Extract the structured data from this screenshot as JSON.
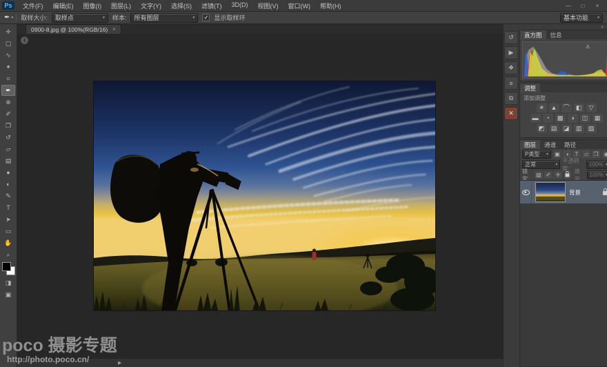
{
  "colors": {
    "hist_gray": "#8d8d8d",
    "hist_red": "#d23a2e",
    "hist_green": "#3fae3f",
    "hist_blue": "#2f5fd0",
    "hist_yellow": "#e8d83a",
    "foreground_swatch": "#000000",
    "background_swatch": "#ffffff",
    "selected_layer_bg": "#57616d"
  },
  "ui": {
    "caret": "▾",
    "menu": "≡",
    "collapse": "»",
    "check": "✓",
    "warning": "⚠",
    "play": "▶",
    "info": "i"
  },
  "app": {
    "logo": "Ps",
    "window_controls": [
      {
        "name": "minimize-button",
        "glyph": "—"
      },
      {
        "name": "maximize-button",
        "glyph": "□"
      },
      {
        "name": "close-button",
        "glyph": "×"
      }
    ]
  },
  "menubar": {
    "items": [
      {
        "name": "menu-file",
        "label": "文件(F)"
      },
      {
        "name": "menu-edit",
        "label": "编辑(E)"
      },
      {
        "name": "menu-image",
        "label": "图像(I)"
      },
      {
        "name": "menu-layer",
        "label": "图层(L)"
      },
      {
        "name": "menu-type",
        "label": "文字(Y)"
      },
      {
        "name": "menu-select",
        "label": "选择(S)"
      },
      {
        "name": "menu-filter",
        "label": "滤镜(T)"
      },
      {
        "name": "menu-3d",
        "label": "3D(D)"
      },
      {
        "name": "menu-view",
        "label": "视图(V)"
      },
      {
        "name": "menu-window",
        "label": "窗口(W)"
      },
      {
        "name": "menu-help",
        "label": "帮助(H)"
      }
    ]
  },
  "options_bar": {
    "tool_glyph": "✒",
    "sample_size_label": "取样大小:",
    "sample_size_value": "取样点",
    "sample_label": "样本:",
    "sample_value": "所有图层",
    "show_ring_label": "显示取样环",
    "workspace_value": "基本功能"
  },
  "document": {
    "tab_title": "0900-8.jpg @ 100%(RGB/16)",
    "tab_close": "×"
  },
  "toolbar": {
    "tools": [
      {
        "name": "move-tool",
        "glyph": "✛"
      },
      {
        "name": "marquee-tool",
        "glyph": "▢"
      },
      {
        "name": "lasso-tool",
        "glyph": "∿"
      },
      {
        "name": "quick-selection-tool",
        "glyph": "✦"
      },
      {
        "name": "crop-tool",
        "glyph": "⌗"
      },
      {
        "name": "eyedropper-tool",
        "glyph": "✒",
        "selected": true
      },
      {
        "name": "spot-healing-tool",
        "glyph": "⊕"
      },
      {
        "name": "brush-tool",
        "glyph": "✐"
      },
      {
        "name": "clone-stamp-tool",
        "glyph": "❐"
      },
      {
        "name": "history-brush-tool",
        "glyph": "↺"
      },
      {
        "name": "eraser-tool",
        "glyph": "▱"
      },
      {
        "name": "gradient-tool",
        "glyph": "▤"
      },
      {
        "name": "blur-tool",
        "glyph": "●"
      },
      {
        "name": "dodge-tool",
        "glyph": "◐"
      },
      {
        "name": "pen-tool",
        "glyph": "✎"
      },
      {
        "name": "type-tool",
        "glyph": "T"
      },
      {
        "name": "path-selection-tool",
        "glyph": "➤"
      },
      {
        "name": "shape-tool",
        "glyph": "▭"
      },
      {
        "name": "hand-tool",
        "glyph": "✋"
      },
      {
        "name": "zoom-tool",
        "glyph": "⌕"
      }
    ],
    "extra_buttons": [
      {
        "name": "quick-mask-button",
        "glyph": "◨"
      },
      {
        "name": "screen-mode-button",
        "glyph": "▣"
      }
    ]
  },
  "dock": {
    "strip_icons": [
      {
        "name": "panel-history-icon",
        "glyph": "↺"
      },
      {
        "name": "panel-actions-icon",
        "glyph": "▶"
      },
      {
        "name": "panel-styles-icon",
        "glyph": "❖"
      },
      {
        "name": "panel-properties-icon",
        "glyph": "≡"
      },
      {
        "name": "panel-clone-source-icon",
        "glyph": "⧉"
      },
      {
        "name": "panel-close-icon",
        "glyph": "✕",
        "danger": true
      }
    ]
  },
  "panels": {
    "histogram": {
      "tabs": [
        {
          "name": "tab-histogram",
          "label": "直方图",
          "selected": true
        },
        {
          "name": "tab-info",
          "label": "信息"
        }
      ]
    },
    "adjustments": {
      "title": "调整",
      "hint": "添加调整",
      "row1": [
        {
          "name": "adj-brightness-contrast-icon",
          "glyph": "☀"
        },
        {
          "name": "adj-levels-icon",
          "glyph": "▲"
        },
        {
          "name": "adj-curves-icon",
          "glyph": "⌒"
        },
        {
          "name": "adj-exposure-icon",
          "glyph": "◧"
        },
        {
          "name": "adj-vibrance-icon",
          "glyph": "▽"
        }
      ],
      "row2": [
        {
          "name": "adj-hue-saturation-icon",
          "glyph": "▬"
        },
        {
          "name": "adj-color-balance-icon",
          "glyph": "◔"
        },
        {
          "name": "adj-black-white-icon",
          "glyph": "▩"
        },
        {
          "name": "adj-photo-filter-icon",
          "glyph": "◑"
        },
        {
          "name": "adj-channel-mixer-icon",
          "glyph": "◫"
        },
        {
          "name": "adj-color-lookup-icon",
          "glyph": "▦"
        }
      ],
      "row3": [
        {
          "name": "adj-invert-icon",
          "glyph": "◩"
        },
        {
          "name": "adj-posterize-icon",
          "glyph": "▤"
        },
        {
          "name": "adj-threshold-icon",
          "glyph": "◪"
        },
        {
          "name": "adj-gradient-map-icon",
          "glyph": "▥"
        },
        {
          "name": "adj-selective-color-icon",
          "glyph": "▧"
        }
      ]
    },
    "layers": {
      "tabs": [
        {
          "name": "tab-layers",
          "label": "图层",
          "selected": true
        },
        {
          "name": "tab-channels",
          "label": "通道"
        },
        {
          "name": "tab-paths",
          "label": "路径"
        }
      ],
      "filter": {
        "kind_label": "P类型",
        "icons": [
          {
            "name": "filter-pixel-layers-icon",
            "glyph": "▣"
          },
          {
            "name": "filter-adjustment-layers-icon",
            "glyph": "◑"
          },
          {
            "name": "filter-type-layers-icon",
            "glyph": "T"
          },
          {
            "name": "filter-shape-layers-icon",
            "glyph": "▱"
          },
          {
            "name": "filter-smart-objects-icon",
            "glyph": "❒"
          }
        ],
        "toggle_glyph": "◉"
      },
      "blend": {
        "mode_value": "正常",
        "opacity_label": "不透明度:",
        "opacity_value": "100%"
      },
      "lock": {
        "label": "锁定:",
        "icons": [
          {
            "name": "lock-transparent-icon",
            "glyph": "▨"
          },
          {
            "name": "lock-pixels-icon",
            "glyph": "✐"
          },
          {
            "name": "lock-position-icon",
            "glyph": "✛"
          }
        ],
        "fill_label": "填充:",
        "fill_value": "100%"
      },
      "background_layer": {
        "name_label": "背景"
      }
    }
  },
  "statusbar": {
    "play_glyph": "▶"
  },
  "watermark": {
    "title": "poco 摄影专题",
    "url": "http://photo.poco.cn/"
  }
}
